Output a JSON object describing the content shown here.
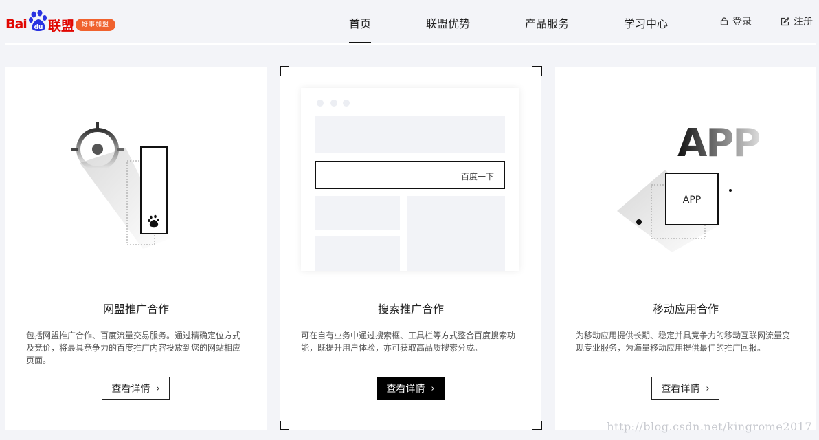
{
  "logo": {
    "brand_left": "Bai",
    "brand_mid": "du",
    "brand_right": "联盟",
    "slogan": "好事加盟"
  },
  "nav": {
    "items": [
      {
        "label": "首页",
        "active": true
      },
      {
        "label": "联盟优势",
        "active": false
      },
      {
        "label": "产品服务",
        "active": false
      },
      {
        "label": "学习中心",
        "active": false
      }
    ],
    "login": "登录",
    "register": "注册"
  },
  "cards": [
    {
      "title": "网盟推广合作",
      "description": "包括网盟推广合作、百度流量交易服务。通过精确定位方式及竞价，将最具竞争力的百度推广内容投放到您的网站相应页面。",
      "button": "查看详情",
      "button_active": false
    },
    {
      "title": "搜索推广合作",
      "description": "可在自有业务中通过搜索框、工具栏等方式整合百度搜索功能，既提升用户体验，亦可获取高品质搜索分成。",
      "button": "查看详情",
      "button_active": true,
      "search_button_text": "百度一下"
    },
    {
      "title": "移动应用合作",
      "description": "为移动应用提供长期、稳定并具竞争力的移动互联网流量变现专业服务，为海量移动应用提供最佳的推广回报。",
      "button": "查看详情",
      "button_active": false,
      "illustration_large": "APP",
      "illustration_small": "APP"
    }
  ],
  "watermark": "http://blog.csdn.net/kingrome2017",
  "colors": {
    "brand_red": "#e10601",
    "brand_blue": "#2932e1",
    "slogan_orange": "#f0622e",
    "page_bg": "#f3f4f8",
    "active_button": "#000000"
  }
}
